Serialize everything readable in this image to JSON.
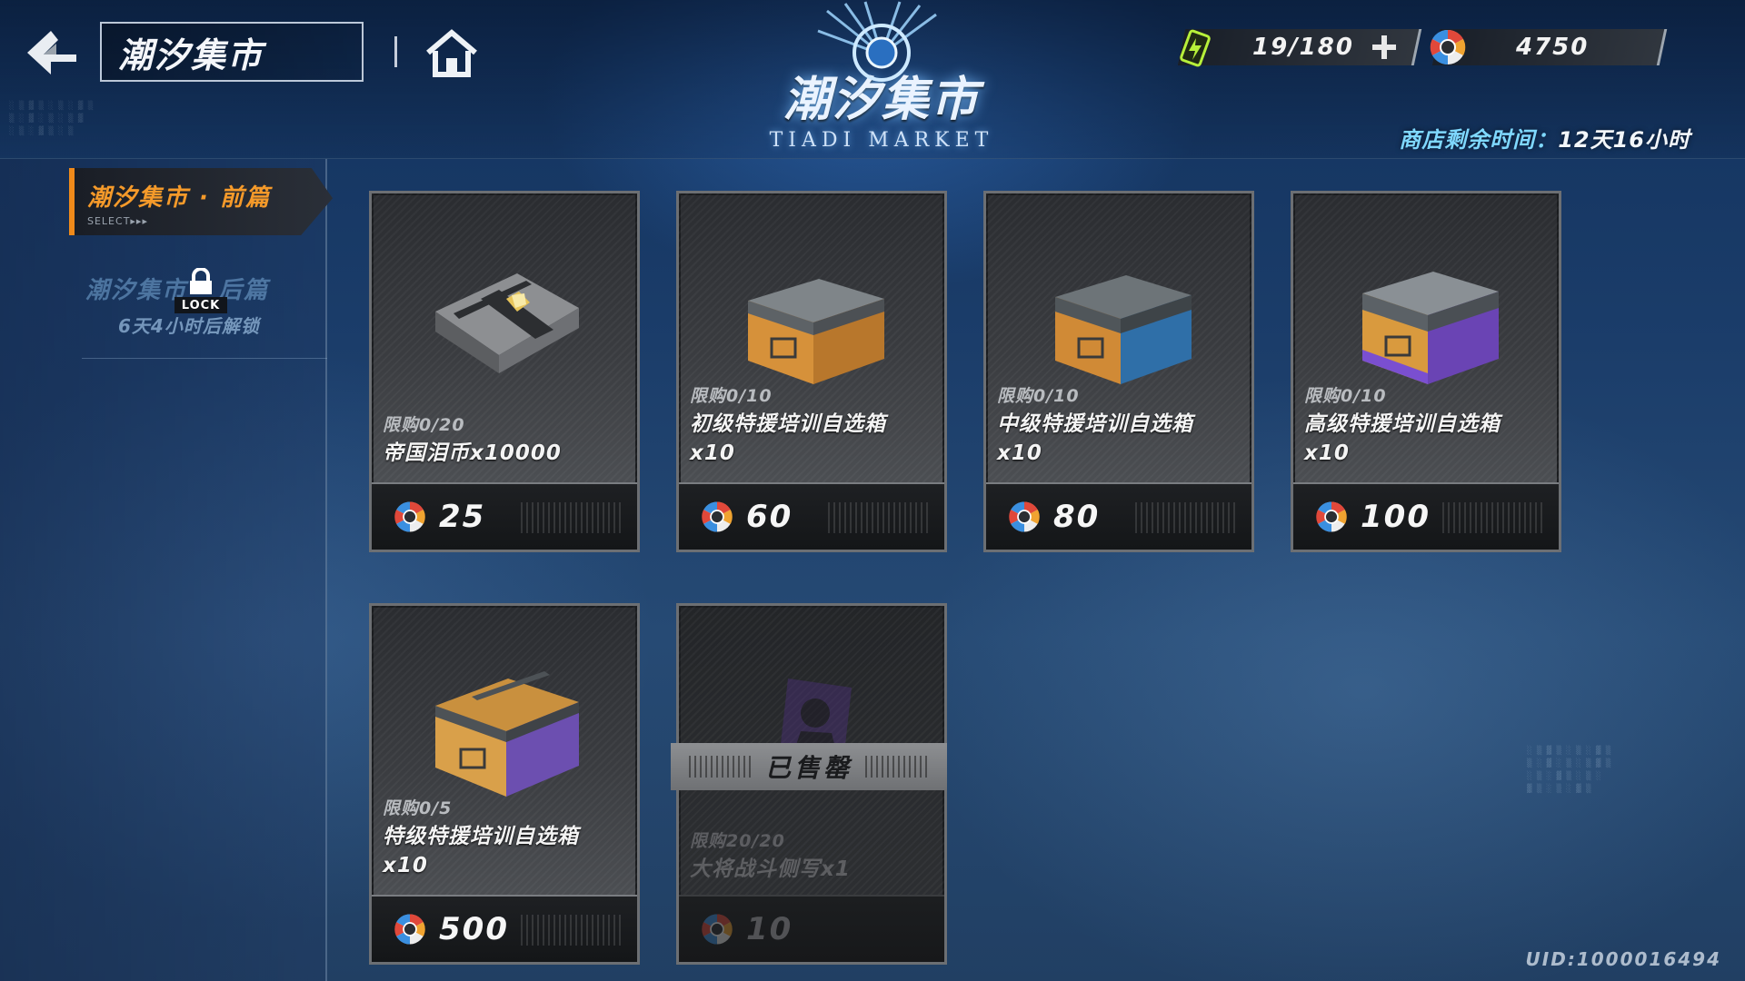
{
  "header": {
    "title": "潮汐集市",
    "logo_cn": "潮汐集市",
    "logo_en": "TIADI MARKET",
    "stamina": "19/180",
    "coins": "4750",
    "timer_label": "商店剩余时间：",
    "timer_value": "12天16小时"
  },
  "sidebar": {
    "tabs": [
      {
        "label": "潮汐集市 · 前篇",
        "sub": "SELECT▸▸▸",
        "active": true
      },
      {
        "label": "潮汐集市 · 后篇",
        "lock": "LOCK",
        "unlock_note": "6天4小时后解锁",
        "active": false
      }
    ]
  },
  "items": [
    {
      "limit": "限购0/20",
      "name": "帝国泪币x10000",
      "price": "25",
      "icon": "wrapped-bundle-icon",
      "sold": false
    },
    {
      "limit": "限购0/10",
      "name": "初级特援培训自选箱x10",
      "price": "60",
      "icon": "gray-supply-crate-icon",
      "sold": false
    },
    {
      "limit": "限购0/10",
      "name": "中级特援培训自选箱x10",
      "price": "80",
      "icon": "blue-supply-crate-icon",
      "sold": false
    },
    {
      "limit": "限购0/10",
      "name": "高级特援培训自选箱x10",
      "price": "100",
      "icon": "purple-supply-crate-icon",
      "sold": false
    },
    {
      "limit": "限购0/5",
      "name": "特级特援培训自选箱x10",
      "price": "500",
      "icon": "gold-supply-crate-icon",
      "sold": false
    },
    {
      "limit": "限购20/20",
      "name": "大将战斗侧写x1",
      "price": "10",
      "icon": "portrait-card-icon",
      "sold": true,
      "sold_label": "已售罄"
    }
  ],
  "footer": {
    "uid": "UID:1000016494"
  },
  "colors": {
    "accent_orange": "#f08a1a",
    "timer_cyan": "#7fd8ff",
    "bg_blue": "#1b3d6a"
  }
}
